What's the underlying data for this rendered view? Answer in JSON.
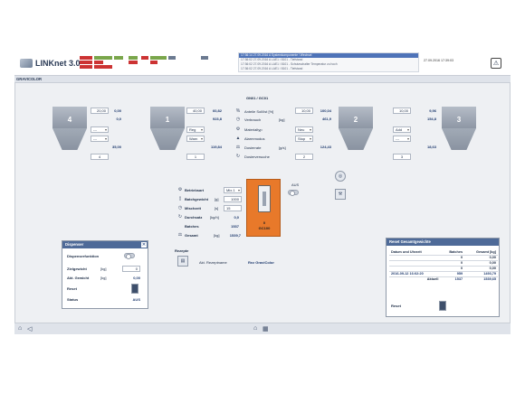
{
  "app": {
    "title": "LINKnet 3.0",
    "section": "GRAVICOLOR"
  },
  "alarms": [
    {
      "text": "17:36:14  27.09.2016 A  Systemkomponente / Wechsel",
      "active": true
    },
    {
      "text": "17:36:02  27.09.2016 A  LAE1 / 8101 - Tiefstand",
      "active": false
    },
    {
      "text": "17:36:02  27.09.2016 A  LAE1 / 8101 - Schutzschalter Temperatur zu hoch",
      "active": false
    },
    {
      "text": "17:36:02  27.09.2016 A  LAE1 / 8101 - Tiefstand",
      "active": false
    }
  ],
  "datetime": "27.09.2016 17:39:03",
  "colors": {
    "accent": "#4e6a98",
    "orange": "#e8792a",
    "alarm_active": "#4e73b8"
  },
  "station": {
    "title": "GN01 / GC01"
  },
  "hoppers": [
    {
      "label": "4",
      "set": "20,00",
      "act": "0,00",
      "total": "0,0",
      "mode1": "---",
      "mode2": "---",
      "dose": "35,00",
      "count": "4"
    },
    {
      "label": "1",
      "set": "40,00",
      "act": "60,82",
      "total": "923,8",
      "mode1": "Reg",
      "mode2": "Warn",
      "dose": "119,84",
      "count": "1"
    },
    {
      "label": "2",
      "set": "10,00",
      "act": "100,04",
      "total": "461,9",
      "mode1": "Neu",
      "mode2": "Stop",
      "dose": "124,43",
      "count": "2"
    },
    {
      "label": "3",
      "set": "10,00",
      "act": "9,96",
      "total": "154,8",
      "mode1": "Add",
      "mode2": "---",
      "dose": "18,63",
      "count": "3"
    }
  ],
  "params": {
    "anteile": "Anteile Soll/Ist [%]",
    "verbrauch": "Verbrauch",
    "verbrauch_unit": "[kg]",
    "materialtyp": "Materialtyp",
    "alarmmodus": "Alarmmodus",
    "dosierrate": "Dosierrate",
    "dosierrate_unit": "[g/s]",
    "dosierversuche": "Dosierversuche"
  },
  "batch": {
    "betriebsart_label": "Betriebsart",
    "betriebsart": "Mix.1",
    "batchgewicht_label": "Batchgewicht",
    "batchgewicht_unit": "[g]",
    "batchgewicht": "1000",
    "mischzeit_label": "Mischzeit",
    "mischzeit_unit": "[s]",
    "mischzeit": "15",
    "durchsatz_label": "Durchsatz",
    "durchsatz_unit": "[kg/h]",
    "durchsatz": "0,0",
    "batches_label": "Batches",
    "batches": "1537",
    "gesamt_label": "Gesamt",
    "gesamt_unit": "[kg]",
    "gesamt": "1539,7"
  },
  "mixer": {
    "count": "0",
    "name": "GC100",
    "state_label": "AUS"
  },
  "recipe": {
    "title": "Rezepte",
    "name_label": "Akt. Rezeptname",
    "name": "Rez GraviColor"
  },
  "dispenser": {
    "title": "Dispenser",
    "funktion_label": "Dispenserfunktion",
    "ziel_label": "Zielgewicht",
    "ziel_unit": "[kg]",
    "ziel": "0",
    "akt_label": "Akt. Gewicht",
    "akt_unit": "[kg]",
    "akt": "0,00",
    "reset_label": "Reset",
    "status_label": "Status",
    "status": "AUS"
  },
  "reset_panel": {
    "title": "Reset Gesamtgewichte",
    "headers": [
      "Datum und Uhrzeit",
      "Batches",
      "Gesamt [kg]"
    ],
    "rows": [
      [
        "",
        "0",
        "0,00"
      ],
      [
        "",
        "0",
        "0,00"
      ],
      [
        "",
        "0",
        "0,00"
      ],
      [
        "2016-09-12 16:02:20",
        "959",
        "1493,79"
      ],
      [
        "Aktuell",
        "1537",
        "1539,65"
      ]
    ],
    "reset_label": "Reset"
  }
}
